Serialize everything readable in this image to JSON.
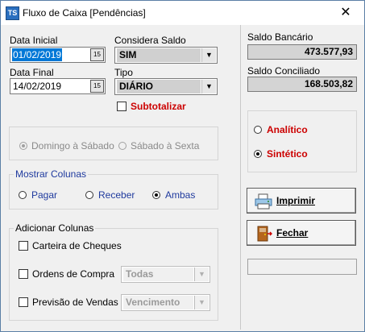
{
  "window": {
    "title": "Fluxo de Caixa [Pendências]",
    "close_glyph": "✕",
    "icon_text": "TS"
  },
  "dates": {
    "start_label": "Data Inicial",
    "start_value": "01/02/2019",
    "end_label": "Data Final",
    "end_value": "14/02/2019",
    "calendar_icon_text": "15"
  },
  "considera_saldo": {
    "label": "Considera Saldo",
    "value": "SIM"
  },
  "tipo": {
    "label": "Tipo",
    "value": "DIÁRIO"
  },
  "subtotalizar": {
    "label": "Subtotalizar",
    "checked": false
  },
  "weekdays": {
    "options": [
      "Domingo à Sábado",
      "Sábado à Sexta"
    ],
    "selected": 0,
    "enabled": false
  },
  "mostrar_colunas": {
    "title": "Mostrar Colunas",
    "options": [
      "Pagar",
      "Receber",
      "Ambas"
    ],
    "selected": 2
  },
  "adicionar_colunas": {
    "title": "Adicionar Colunas",
    "carteira_label": "Carteira de Cheques",
    "ordens_label": "Ordens de Compra",
    "ordens_select": "Todas",
    "previsao_label": "Previsão de Vendas",
    "previsao_select": "Vencimento"
  },
  "saldo": {
    "bancario_label": "Saldo Bancário",
    "bancario_value": "473.577,93",
    "conciliado_label": "Saldo Conciliado",
    "conciliado_value": "168.503,82"
  },
  "modo": {
    "options": [
      "Analítico",
      "Sintético"
    ],
    "selected": 1
  },
  "buttons": {
    "imprimir": "Imprimir",
    "fechar": "Fechar"
  },
  "colors": {
    "selection": "#0078d7",
    "red_label": "#cc0000",
    "blue_label": "#1f3a9e"
  }
}
